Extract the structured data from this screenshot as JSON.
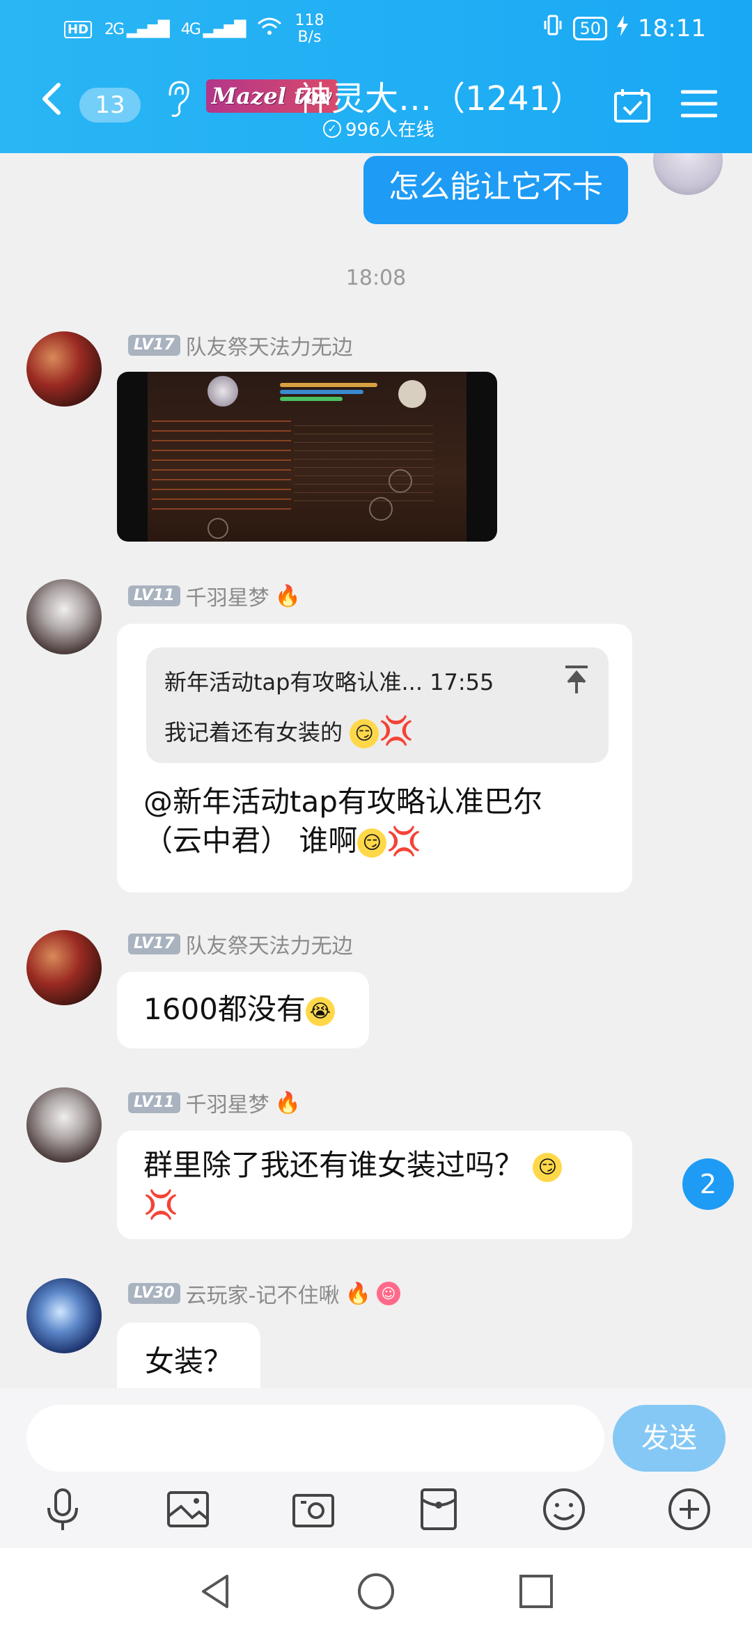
{
  "status_bar": {
    "hd_label": "HD",
    "sim1": "2G",
    "sim2": "4G",
    "net_speed_value": "118",
    "net_speed_unit": "B/s",
    "battery": "50",
    "time": "18:11"
  },
  "header": {
    "unread_count": "13",
    "logo_text": "Mazel tov",
    "group_title": "神灵大…（1241）",
    "online_text": "996人在线"
  },
  "my_message": {
    "text": "怎么能让它不卡"
  },
  "timestamp": "18:08",
  "messages": [
    {
      "level": "LV17",
      "sender": "队友祭天法力无边"
    },
    {
      "level": "LV11",
      "sender": "千羽星梦",
      "reply_title": "新年活动tap有攻略认准... 17:55",
      "reply_text": "我记着还有女装的",
      "line1": "@新年活动tap有攻略认准巴尔",
      "line2": "（云中君） 谁啊"
    },
    {
      "level": "LV17",
      "sender": "队友祭天法力无边",
      "text": "1600都没有"
    },
    {
      "level": "LV11",
      "sender": "千羽星梦",
      "text": "群里除了我还有谁女装过吗？"
    },
    {
      "level": "LV30",
      "sender": "云玩家-记不住啾",
      "text": "女装？"
    }
  ],
  "new_message_badge": "2",
  "input": {
    "placeholder": "",
    "send_label": "发送"
  },
  "colors": {
    "header": "#19a8f4",
    "my_bubble": "#1e9bf5",
    "send_button": "#85c8f5"
  }
}
